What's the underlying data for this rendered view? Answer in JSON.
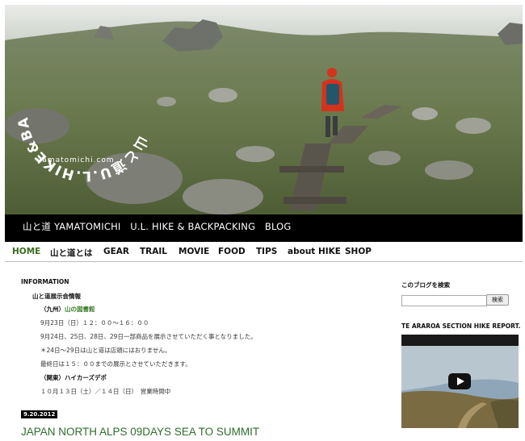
{
  "header": {
    "circle_text": "山と道U.L.HIKE&BACKPACKING",
    "url_text": "yamatomichi.com",
    "blog_title": "山と道 YAMATOMICHI　U.L. HIKE & BACKPACKING　BLOG"
  },
  "nav": {
    "items": [
      "HOME",
      "山と道とは",
      "GEAR",
      "TRAIL",
      "MOVIE",
      "FOOD",
      "TIPS",
      "about HIKE",
      "SHOP"
    ],
    "active_color": "#3a6b1e"
  },
  "main": {
    "info_heading": "INFORMATION",
    "lines": {
      "l1": "山と道展示会情報",
      "l2_prefix": "（九州）",
      "l2_link": "山の図書館",
      "l3": "9月23日（日）１２：００〜１６：００",
      "l4": "9月24日、25日、28日、29日一部商品を展示させていただく事となりました。",
      "l5": "＊24日〜29日は山と道は店頭にはおりません。",
      "l6": "最終日は１５：００までの展示とさせていただきます。",
      "l7": "（関東）ハイカーズデポ",
      "l8": "１０月１３日（土）／１４日（日）　営業時間中"
    },
    "post_date": "9.20.2012",
    "post_title": "JAPAN NORTH ALPS 09DAYS SEA TO SUMMIT",
    "title_color": "#2f6d2b"
  },
  "sidebar": {
    "search_heading": "このブログを検索",
    "search_placeholder": "",
    "search_button": "検索",
    "video_heading": "TE ARAROA SECTION HIKE REPORT."
  }
}
